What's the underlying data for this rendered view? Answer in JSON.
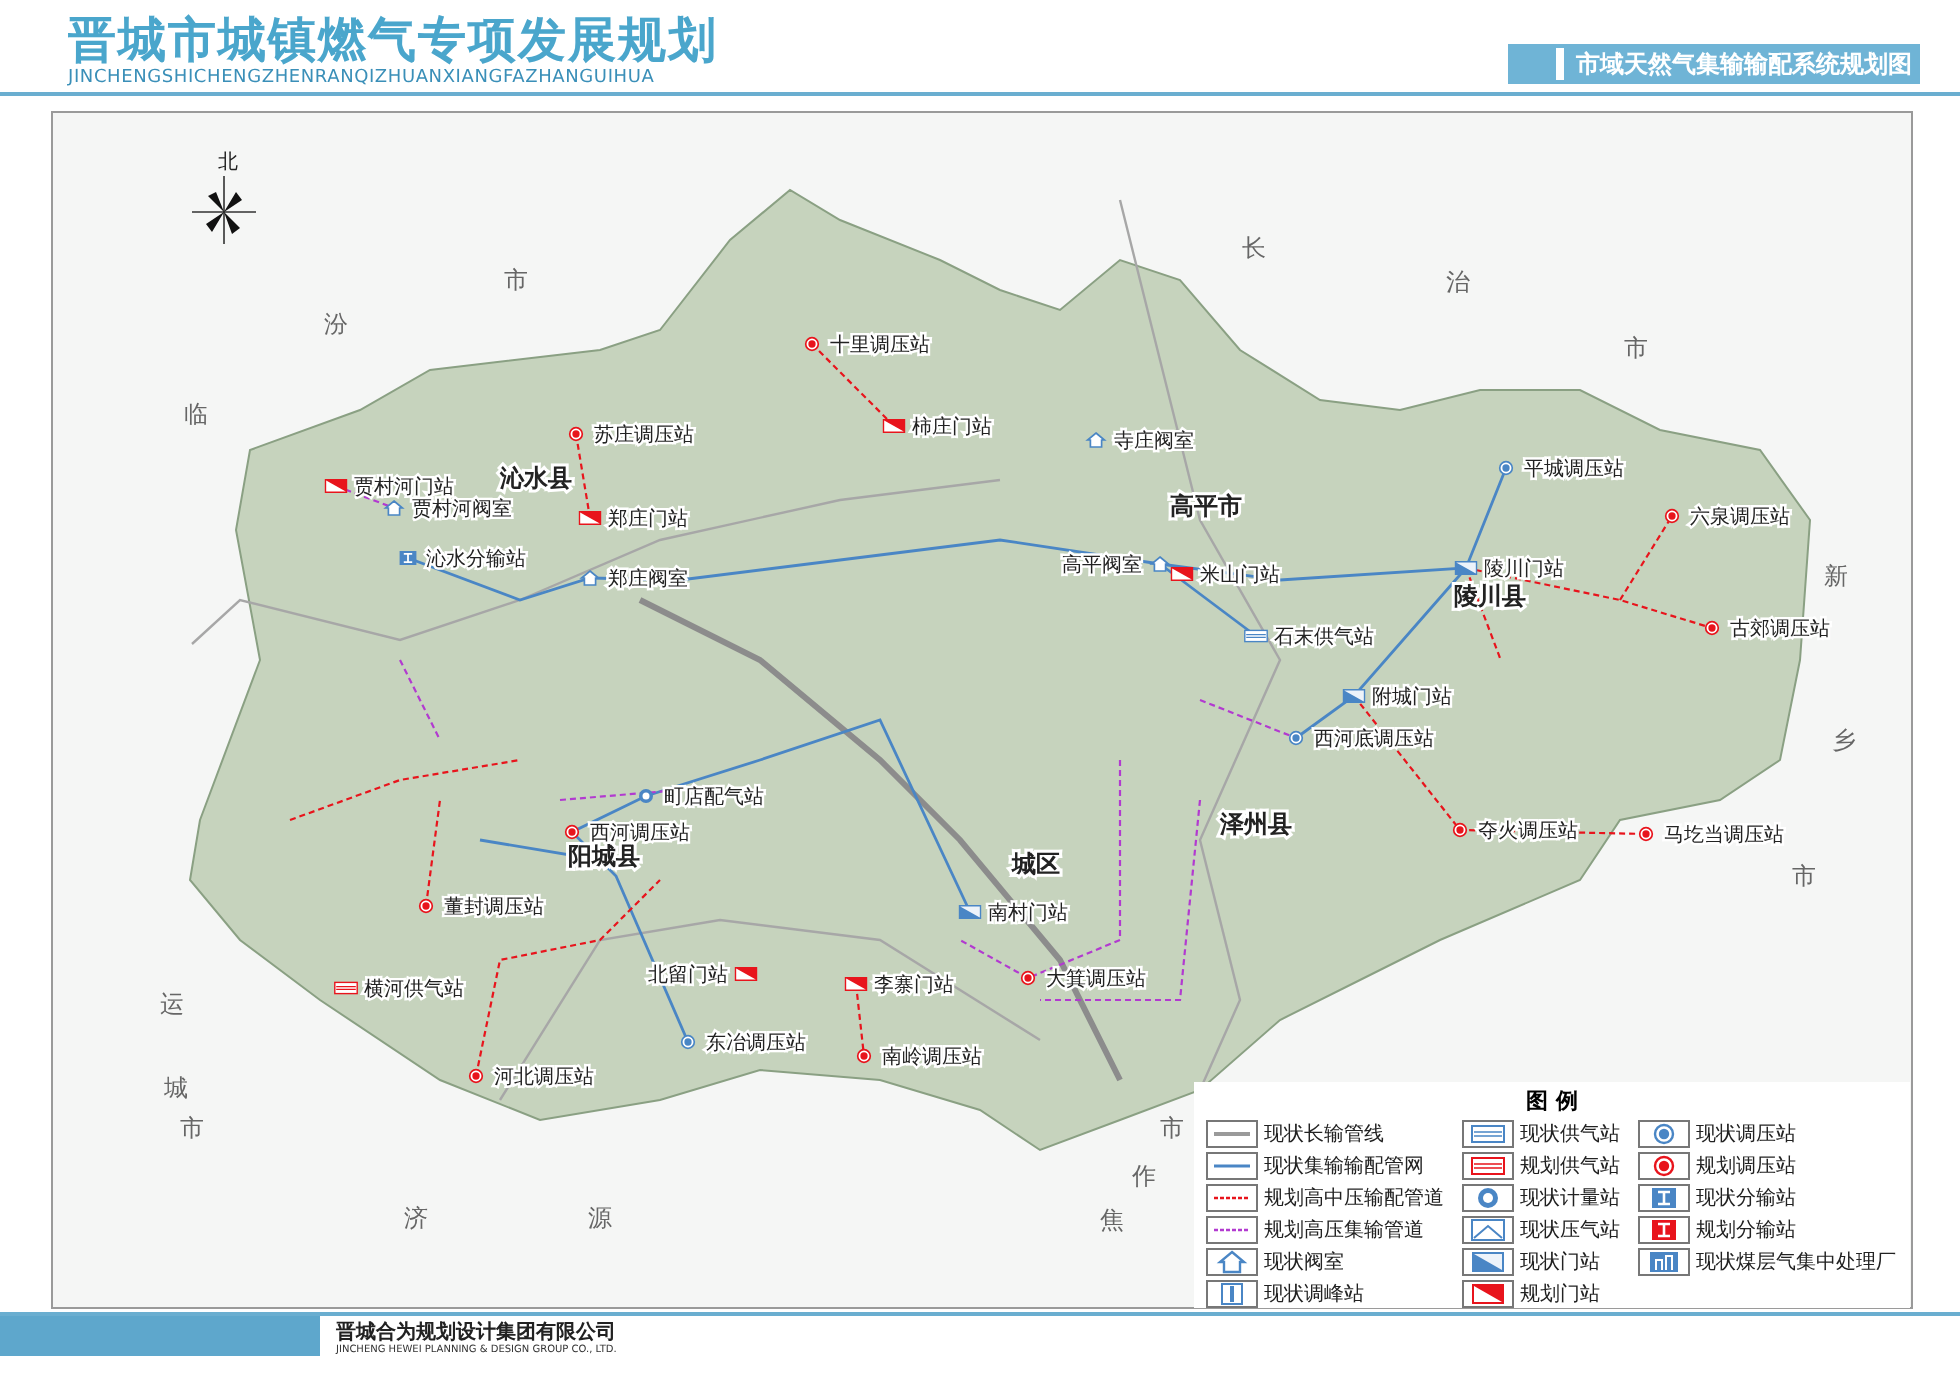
{
  "header": {
    "title": "晋城市城镇燃气专项发展规划",
    "pinyin": "JINCHENGSHICHENGZHENRANQIZHUANXIANGFAZHANGUIHUA",
    "drawing_title": "市域天然气集输输配系统规划图"
  },
  "map": {
    "north_label": "北",
    "surrounding_labels": [
      {
        "text": "市"
      },
      {
        "text": "汾"
      },
      {
        "text": "临"
      },
      {
        "text": "长"
      },
      {
        "text": "治"
      },
      {
        "text": "市"
      },
      {
        "text": "新"
      },
      {
        "text": "乡"
      },
      {
        "text": "市"
      },
      {
        "text": "运"
      },
      {
        "text": "城"
      },
      {
        "text": "市"
      },
      {
        "text": "济"
      },
      {
        "text": "源"
      },
      {
        "text": "焦"
      },
      {
        "text": "作"
      },
      {
        "text": "市"
      }
    ],
    "county_labels": [
      {
        "text": "沁水县"
      },
      {
        "text": "高平市"
      },
      {
        "text": "陵川县"
      },
      {
        "text": "阳城县"
      },
      {
        "text": "城区"
      },
      {
        "text": "泽州县"
      }
    ],
    "stations": [
      {
        "name": "十里调压站",
        "kind": "regulator_planned"
      },
      {
        "name": "柿庄门站",
        "kind": "gate_planned"
      },
      {
        "name": "苏庄调压站",
        "kind": "regulator_planned"
      },
      {
        "name": "郑庄门站",
        "kind": "gate_planned"
      },
      {
        "name": "贾村河门站",
        "kind": "gate_planned"
      },
      {
        "name": "贾村河阀室",
        "kind": "valve"
      },
      {
        "name": "沁水分输站",
        "kind": "distribution_existing"
      },
      {
        "name": "郑庄阀室",
        "kind": "valve"
      },
      {
        "name": "六泉调压站",
        "kind": "regulator_planned"
      },
      {
        "name": "古郊调压站",
        "kind": "regulator_planned"
      },
      {
        "name": "陵川门站",
        "kind": "gate_existing"
      },
      {
        "name": "附城门站",
        "kind": "gate_existing"
      },
      {
        "name": "西河底调压站",
        "kind": "regulator_existing"
      },
      {
        "name": "夺火调压站",
        "kind": "regulator_planned"
      },
      {
        "name": "马圪当调压站",
        "kind": "regulator_planned"
      },
      {
        "name": "石末供气站",
        "kind": "supply_existing"
      },
      {
        "name": "高平阀室",
        "kind": "valve"
      },
      {
        "name": "米山门站",
        "kind": "gate_planned"
      },
      {
        "name": "平城调压站",
        "kind": "regulator_existing"
      },
      {
        "name": "寺庄阀室",
        "kind": "valve"
      },
      {
        "name": "西河调压站",
        "kind": "regulator_planned"
      },
      {
        "name": "河北调压站",
        "kind": "regulator_planned"
      },
      {
        "name": "董封调压站",
        "kind": "regulator_planned"
      },
      {
        "name": "横河供气站",
        "kind": "supply_planned"
      },
      {
        "name": "町店配气站",
        "kind": "meter"
      },
      {
        "name": "北留门站",
        "kind": "gate_planned"
      },
      {
        "name": "李寨门站",
        "kind": "gate_planned"
      },
      {
        "name": "南岭调压站",
        "kind": "regulator_planned"
      },
      {
        "name": "东冶调压站",
        "kind": "regulator_existing"
      },
      {
        "name": "大箕调压站",
        "kind": "regulator_planned"
      },
      {
        "name": "南村门站",
        "kind": "gate_existing"
      }
    ]
  },
  "legend": {
    "title": "图 例",
    "items": [
      {
        "label": "现状长输管线",
        "kind": "line_trunk"
      },
      {
        "label": "现状供气站",
        "kind": "supply_existing"
      },
      {
        "label": "现状调压站",
        "kind": "regulator_existing"
      },
      {
        "label": "现状集输输配管网",
        "kind": "line_existing"
      },
      {
        "label": "规划供气站",
        "kind": "supply_planned"
      },
      {
        "label": "规划调压站",
        "kind": "regulator_planned"
      },
      {
        "label": "规划高中压输配管道",
        "kind": "line_planned_mid"
      },
      {
        "label": "现状计量站",
        "kind": "meter"
      },
      {
        "label": "现状分输站",
        "kind": "distribution_existing"
      },
      {
        "label": "规划高压集输管道",
        "kind": "line_planned_high"
      },
      {
        "label": "现状压气站",
        "kind": "compressor"
      },
      {
        "label": "规划分输站",
        "kind": "distribution_planned"
      },
      {
        "label": "现状阀室",
        "kind": "valve"
      },
      {
        "label": "现状门站",
        "kind": "gate_existing"
      },
      {
        "label": "现状煤层气集中处理厂",
        "kind": "cbm_plant"
      },
      {
        "label": "现状调峰站",
        "kind": "peak"
      },
      {
        "label": "规划门站",
        "kind": "gate_planned"
      }
    ]
  },
  "footer": {
    "company": "晋城合为规划设计集团有限公司",
    "company_en": "JINCHENG HEWEI PLANNING & DESIGN GROUP CO., LTD."
  }
}
